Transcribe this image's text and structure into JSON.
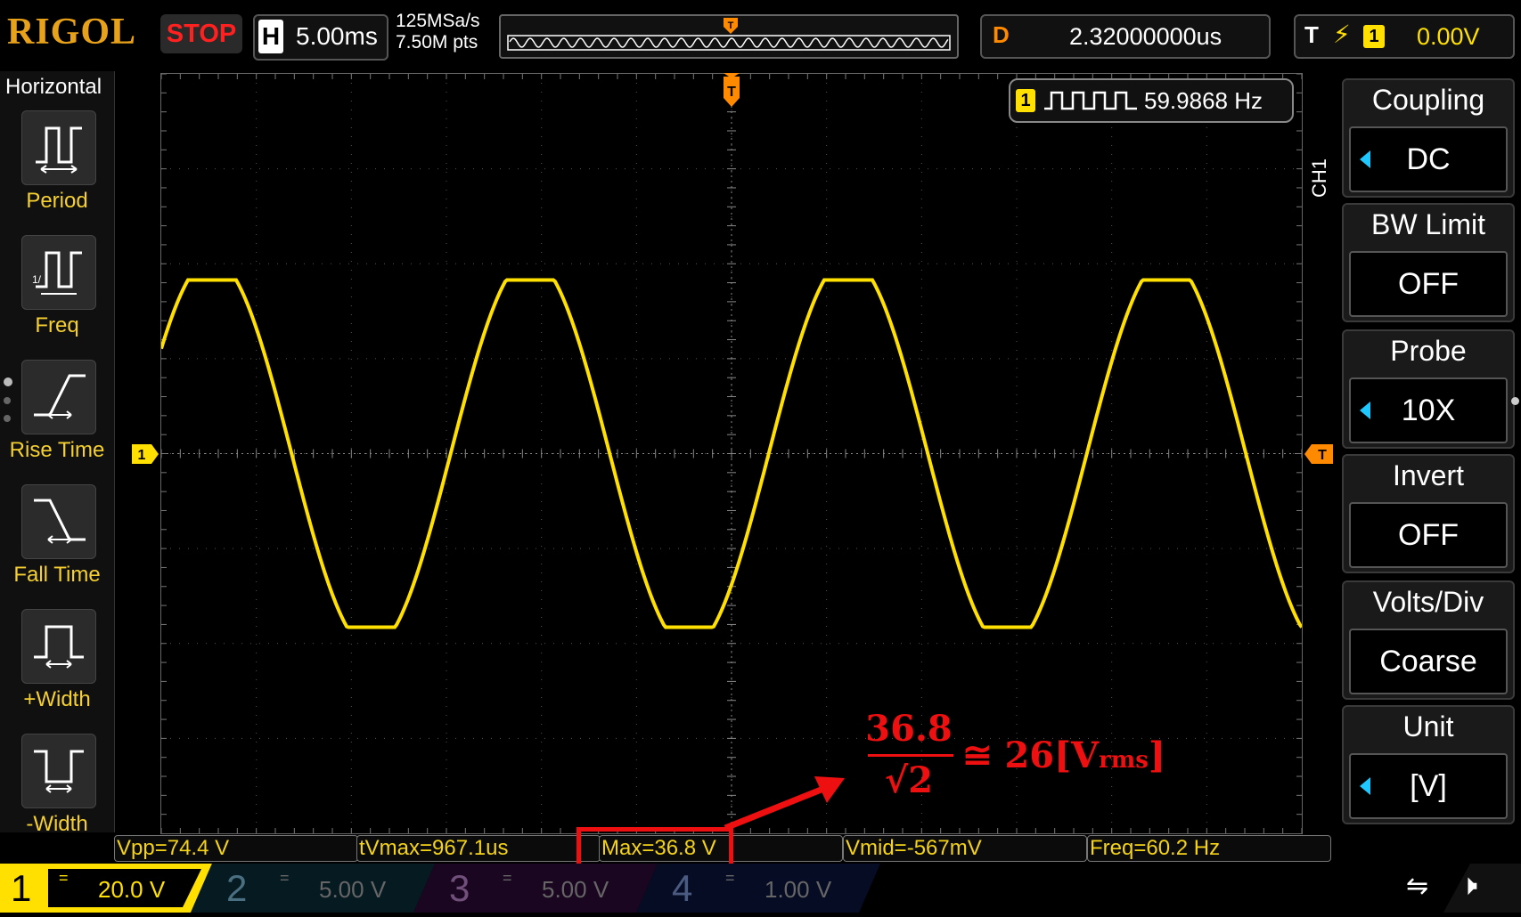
{
  "header": {
    "brand": "RIGOL",
    "run_state": "STOP",
    "timebase_label": "H",
    "timebase_value": "5.00ms",
    "sample_rate": "125MSa/s",
    "memory_depth": "7.50M pts",
    "delay_label": "D",
    "delay_value": "2.32000000us",
    "trigger_label": "T",
    "trigger_channel": "1",
    "trigger_level": "0.00V"
  },
  "left_menu": {
    "title": "Horizontal",
    "items": [
      {
        "label": "Period",
        "icon": "period-icon"
      },
      {
        "label": "Freq",
        "icon": "freq-icon"
      },
      {
        "label": "Rise Time",
        "icon": "rise-time-icon"
      },
      {
        "label": "Fall Time",
        "icon": "fall-time-icon"
      },
      {
        "label": "+Width",
        "icon": "positive-width-icon"
      },
      {
        "label": "-Width",
        "icon": "negative-width-icon"
      }
    ]
  },
  "screen": {
    "freq_counter_channel": "1",
    "freq_counter_value": "59.9868 Hz",
    "channel_marker": "1",
    "trigger_marker": "T"
  },
  "right_menu": {
    "channel_tab": "CH1",
    "items": [
      {
        "header": "Coupling",
        "value": "DC",
        "has_arrow": true
      },
      {
        "header": "BW Limit",
        "value": "OFF",
        "has_arrow": false
      },
      {
        "header": "Probe",
        "value": "10X",
        "has_arrow": true
      },
      {
        "header": "Invert",
        "value": "OFF",
        "has_arrow": false
      },
      {
        "header": "Volts/Div",
        "value": "Coarse",
        "has_arrow": false
      },
      {
        "header": "Unit",
        "value": "[V]",
        "has_arrow": true
      }
    ]
  },
  "measurements": [
    "Vpp=74.4 V",
    "tVmax=967.1us",
    "Max=36.8 V",
    "Vmid=-567mV",
    "Freq=60.2 Hz"
  ],
  "annotation": {
    "numerator": "36.8",
    "denominator": "√2",
    "relation": "≅ 26[V",
    "subscript": "rms",
    "close": "]"
  },
  "channels": [
    {
      "number": "1",
      "coupling": "=",
      "scale": "20.0 V",
      "active": true,
      "color": "#ffe000"
    },
    {
      "number": "2",
      "coupling": "=",
      "scale": "5.00 V",
      "active": false,
      "color": "#1ec8ff"
    },
    {
      "number": "3",
      "coupling": "=",
      "scale": "5.00 V",
      "active": false,
      "color": "#ff3cff"
    },
    {
      "number": "4",
      "coupling": "=",
      "scale": "1.00 V",
      "active": false,
      "color": "#2f6dff"
    }
  ],
  "colors": {
    "trace": "#ffe000",
    "accent": "#ff8a00",
    "annotation": "#ee1010"
  }
}
